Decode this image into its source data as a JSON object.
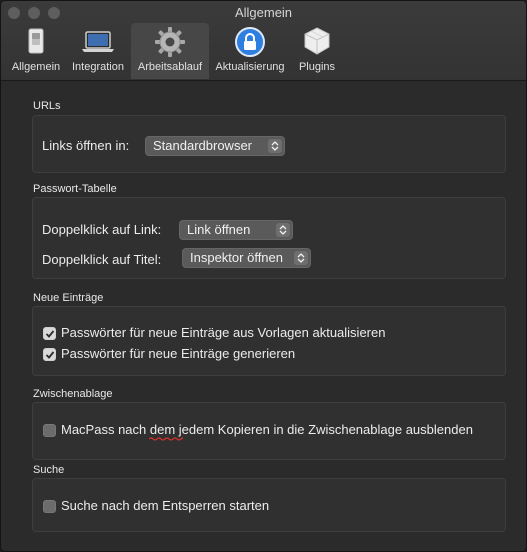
{
  "window": {
    "title": "Allgemein"
  },
  "toolbar": {
    "tabs": [
      {
        "label": "Allgemein",
        "icon": "switch-icon"
      },
      {
        "label": "Integration",
        "icon": "laptop-icon"
      },
      {
        "label": "Arbeitsablauf",
        "icon": "gear-icon",
        "selected": true
      },
      {
        "label": "Aktualisierung",
        "icon": "lock-update-icon"
      },
      {
        "label": "Plugins",
        "icon": "puzzle-box-icon"
      }
    ]
  },
  "sections": {
    "urls": {
      "title": "URLs",
      "links_label": "Links öffnen in:",
      "links_value": "Standardbrowser"
    },
    "password_table": {
      "title": "Passwort-Tabelle",
      "doubleclick_link_label": "Doppelklick auf Link:",
      "doubleclick_link_value": "Link öffnen",
      "doubleclick_title_label": "Doppelklick auf Titel:",
      "doubleclick_title_value": "Inspektor öffnen"
    },
    "new_entries": {
      "title": "Neue Einträge",
      "checkbox1_label": "Passwörter für neue Einträge aus Vorlagen aktualisieren",
      "checkbox1_checked": true,
      "checkbox2_label": "Passwörter für neue Einträge generieren",
      "checkbox2_checked": true
    },
    "clipboard": {
      "title": "Zwischenablage",
      "checkbox_label": "MacPass nach dem jedem Kopieren in die Zwischenablage ausblenden",
      "checkbox_checked": false
    },
    "search": {
      "title": "Suche",
      "checkbox_label": "Suche nach dem Entsperren starten",
      "checkbox_checked": false
    }
  },
  "colors": {
    "window_bg": "#2b2b2b",
    "box_bg": "#303030",
    "popup_bg": "#5a5a5a",
    "spellcheck": "#e0332b"
  }
}
